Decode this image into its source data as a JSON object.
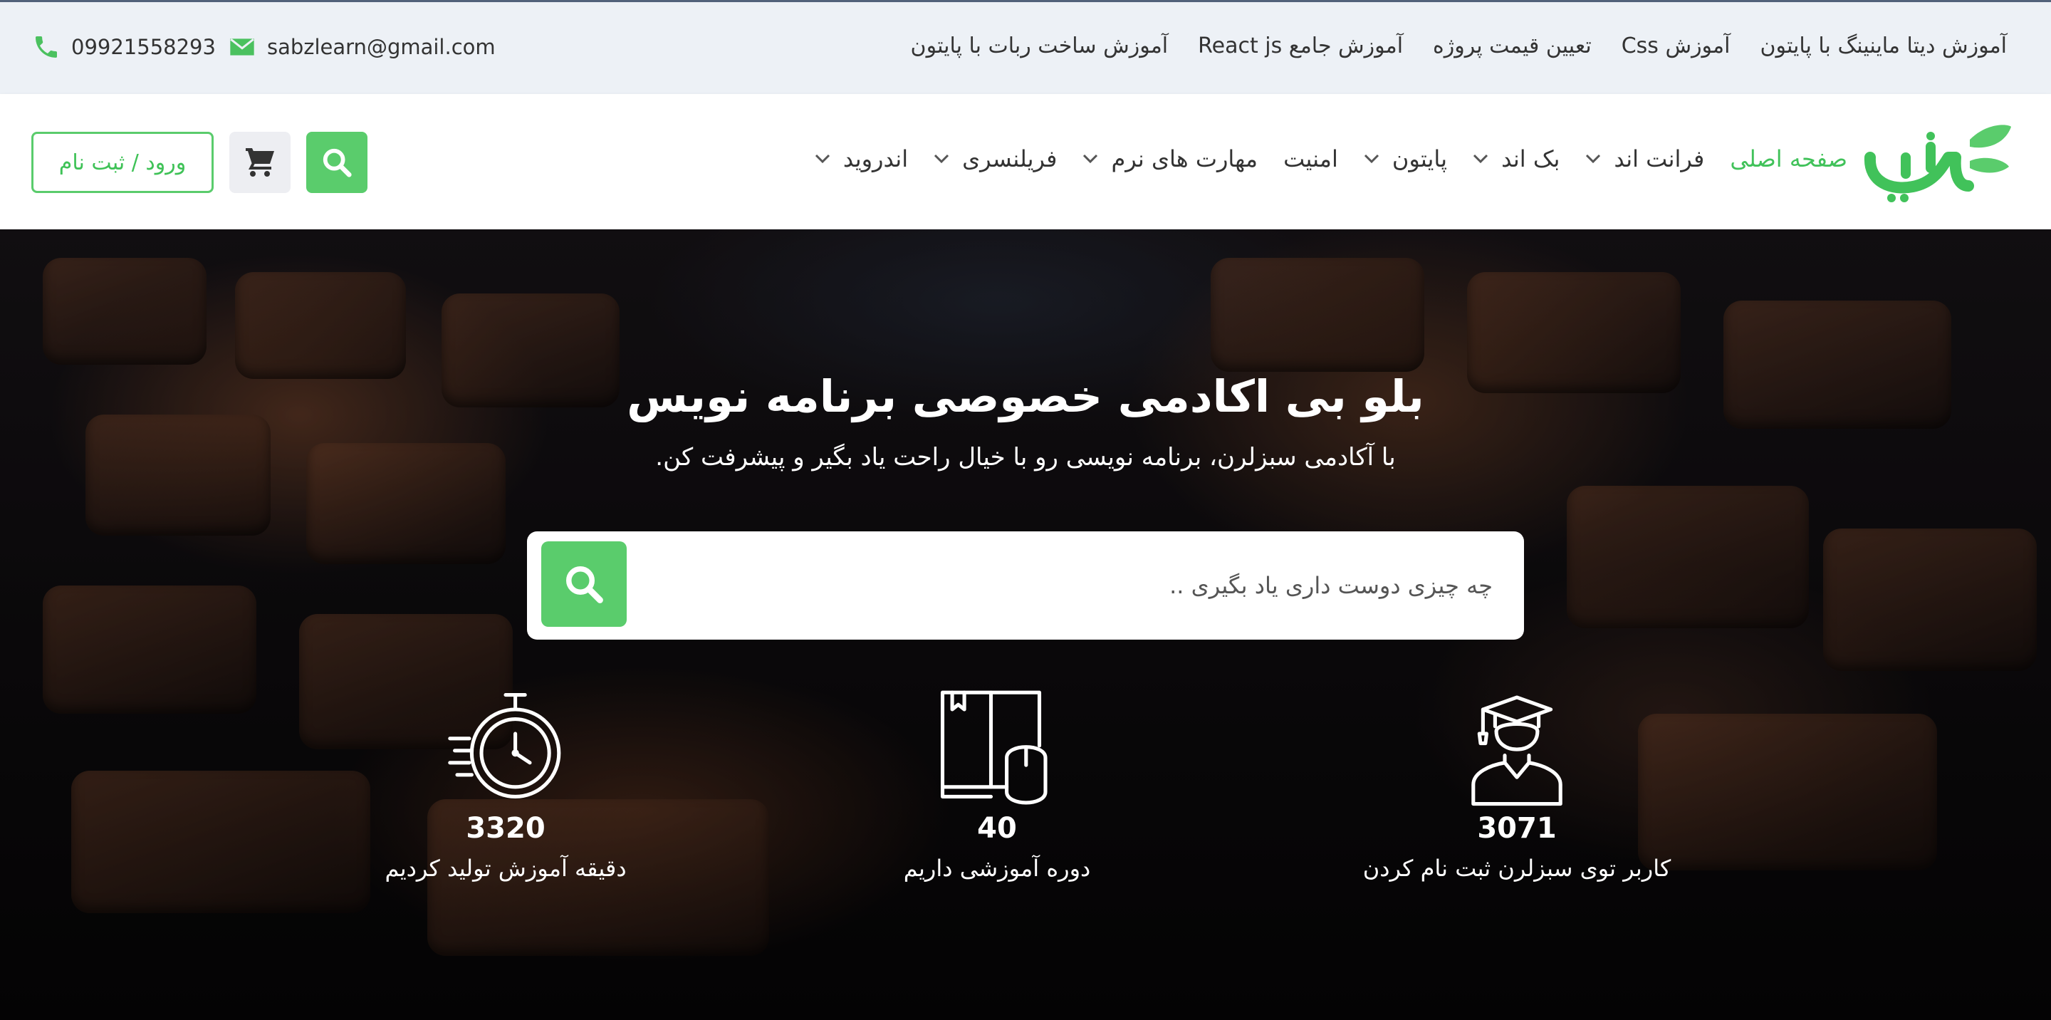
{
  "topbar": {
    "links": [
      "آموزش دیتا ماینینگ با پایتون",
      "آموزش Css",
      "تعیین قیمت پروژه",
      "آموزش جامع React js",
      "آموزش ساخت ربات با پایتون"
    ],
    "email": "sabzlearn@gmail.com",
    "phone": "09921558293"
  },
  "logo": {
    "text": "سبزلرن"
  },
  "nav": {
    "items": [
      {
        "label": "صفحه اصلی",
        "dropdown": false,
        "active": true
      },
      {
        "label": "فرانت اند",
        "dropdown": true,
        "active": false
      },
      {
        "label": "بک اند",
        "dropdown": true,
        "active": false
      },
      {
        "label": "پایتون",
        "dropdown": true,
        "active": false
      },
      {
        "label": "امنیت",
        "dropdown": false,
        "active": false
      },
      {
        "label": "مهارت های نرم",
        "dropdown": true,
        "active": false
      },
      {
        "label": "فریلنسری",
        "dropdown": true,
        "active": false
      },
      {
        "label": "اندروید",
        "dropdown": true,
        "active": false
      }
    ],
    "login_label": "ورود / ثبت نام"
  },
  "hero": {
    "title": "بلو بی اکادمی خصوصی برنامه نویس",
    "subtitle": "با آکادمی سبزلرن، برنامه نویسی رو با خیال راحت یاد بگیر و پیشرفت کن.",
    "search_placeholder": "چه چیزی دوست داری یاد بگیری .."
  },
  "stats": [
    {
      "icon": "graduate-icon",
      "value": "3071",
      "label": "کاربر توی سبزلرن ثبت نام کردن"
    },
    {
      "icon": "book-mouse-icon",
      "value": "40",
      "label": "دوره آموزشی داریم"
    },
    {
      "icon": "stopwatch-icon",
      "value": "3320",
      "label": "دقیقه آموزش تولید کردیم"
    }
  ],
  "colors": {
    "accent": "#5acc6c",
    "topbar_bg": "#edf1f6",
    "header_bg": "#ffffff"
  }
}
